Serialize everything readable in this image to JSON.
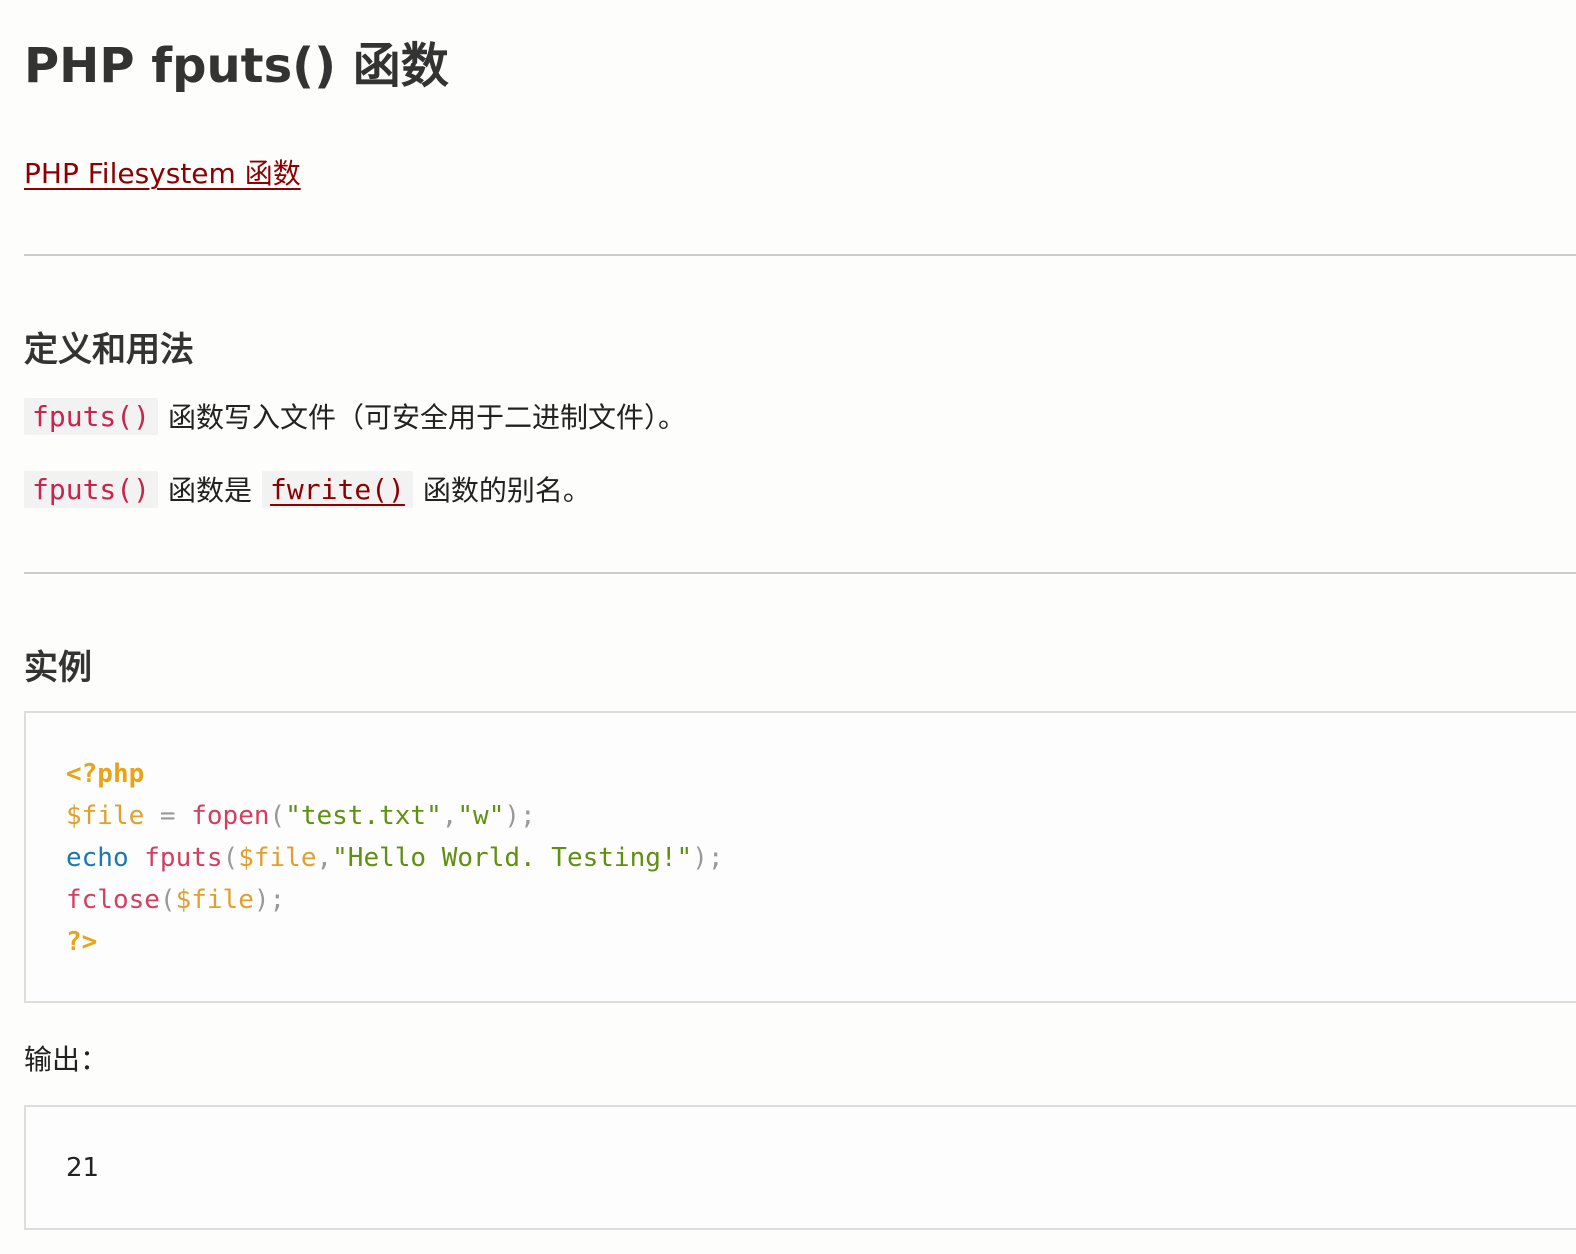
{
  "page": {
    "title": "PHP fputs() 函数",
    "back_link": "PHP Filesystem 函数"
  },
  "definition": {
    "heading": "定义和用法",
    "para1_code": "fputs()",
    "para1_text": "函数写入文件（可安全用于二进制文件）。",
    "para2_code": "fputs()",
    "para2_text_mid": "函数是",
    "para2_link_code": "fwrite()",
    "para2_text_end": "函数的别名。"
  },
  "example": {
    "heading": "实例",
    "code": {
      "line1_tag": "<?php",
      "line2_var": "$file",
      "line2_op": " = ",
      "line2_fn": "fopen",
      "line2_p1": "(",
      "line2_s1": "\"test.txt\"",
      "line2_comma": ",",
      "line2_s2": "\"w\"",
      "line2_p2": ");",
      "line3_kw": "echo",
      "line3_sp": " ",
      "line3_fn": "fputs",
      "line3_p1": "(",
      "line3_var": "$file",
      "line3_comma": ",",
      "line3_str": "\"Hello World. Testing!\"",
      "line3_p2": ");",
      "line4_fn": "fclose",
      "line4_p1": "(",
      "line4_var": "$file",
      "line4_p2": ");",
      "line5_tag": "?>"
    },
    "output_label": "输出：",
    "output_value": "21"
  },
  "colors": {
    "link": "#8b0000",
    "inline_code": "#c7254e",
    "php_tag": "#e8a317",
    "variable": "#e0a030",
    "function": "#d14060",
    "string": "#609010",
    "keyword": "#1a7ab0"
  }
}
